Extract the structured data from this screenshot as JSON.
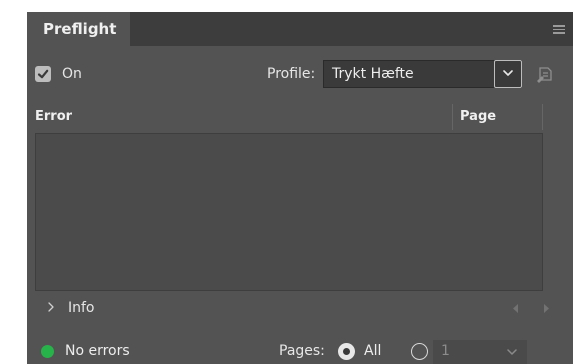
{
  "panel": {
    "tab_title": "Preflight"
  },
  "controls": {
    "on_label": "On",
    "on_checked": true,
    "profile_label": "Profile:",
    "profile_value": "Trykt Hæfte"
  },
  "table": {
    "columns": [
      "Error",
      "Page"
    ],
    "rows": []
  },
  "info": {
    "label": "Info"
  },
  "status": {
    "label": "No errors",
    "color": "#27b24a",
    "pages_label": "Pages:",
    "all_label": "All",
    "range_value": "1",
    "selected_scope": "All"
  },
  "icons": {
    "panel_menu": "hamburger-menu-icon",
    "profile_edit": "define-profiles-icon",
    "info_toggle": "chevron-right-icon",
    "prev": "triangle-left-icon",
    "next": "triangle-right-icon"
  }
}
